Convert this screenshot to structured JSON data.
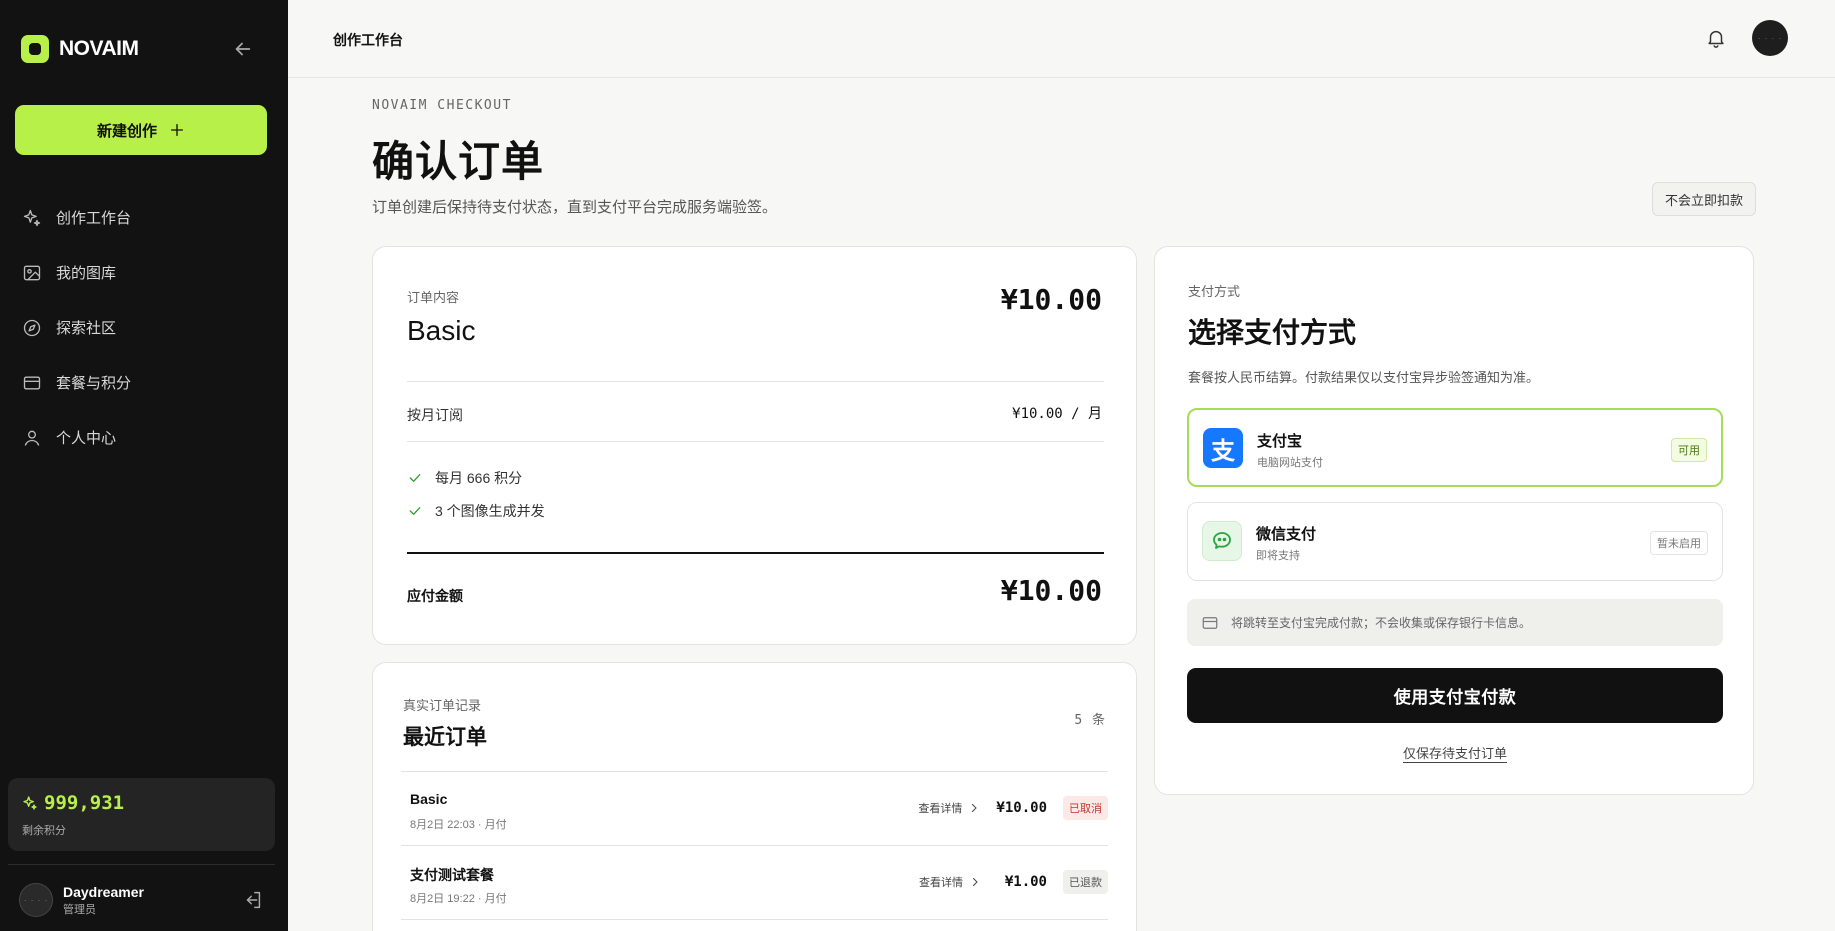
{
  "sidebar": {
    "logo_text": "NOVAIM",
    "new_button": "新建创作",
    "items": [
      {
        "label": "创作工作台",
        "icon": "sparkle-icon"
      },
      {
        "label": "我的图库",
        "icon": "image-icon"
      },
      {
        "label": "探索社区",
        "icon": "compass-icon"
      },
      {
        "label": "套餐与积分",
        "icon": "card-icon"
      },
      {
        "label": "个人中心",
        "icon": "user-icon"
      }
    ],
    "credits": {
      "value": "999,931",
      "label": "剩余积分"
    },
    "user": {
      "name": "Daydreamer",
      "role": "管理员"
    }
  },
  "topbar": {
    "title": "创作工作台"
  },
  "page": {
    "eyebrow": "NOVAIM CHECKOUT",
    "title": "确认订单",
    "subtitle": "订单创建后保持待支付状态，直到支付平台完成服务端验签。",
    "no_charge_chip": "不会立即扣款"
  },
  "order": {
    "label": "订单内容",
    "plan": "Basic",
    "price": "¥10.00",
    "billing_label": "按月订阅",
    "billing_value": "¥10.00 / 月",
    "features": [
      "每月 666 积分",
      "3 个图像生成并发"
    ],
    "total_label": "应付金额",
    "total_value": "¥10.00"
  },
  "recent": {
    "label": "真实订单记录",
    "title": "最近订单",
    "count": "5 条",
    "rows": [
      {
        "name": "Basic",
        "meta": "8月2日 22:03 · 月付",
        "link": "查看详情",
        "amount": "¥10.00",
        "status": "已取消"
      },
      {
        "name": "支付测试套餐",
        "meta": "8月2日 19:22 · 月付",
        "link": "查看详情",
        "amount": "¥1.00",
        "status": "已退款"
      }
    ]
  },
  "payment": {
    "label": "支付方式",
    "title": "选择支付方式",
    "subtitle": "套餐按人民币结算。付款结果仅以支付宝异步验签通知为准。",
    "methods": [
      {
        "name": "支付宝",
        "desc": "电脑网站支付",
        "badge": "可用",
        "icon_glyph": "支"
      },
      {
        "name": "微信支付",
        "desc": "即将支持",
        "badge": "暂未启用"
      }
    ],
    "notice": "将跳转至支付宝完成付款；不会收集或保存银行卡信息。",
    "pay_button": "使用支付宝付款",
    "save_link": "仅保存待支付订单"
  },
  "colors": {
    "accent": "#b8f04a",
    "alipay": "#1677ff",
    "sidebar_bg": "#121212"
  }
}
